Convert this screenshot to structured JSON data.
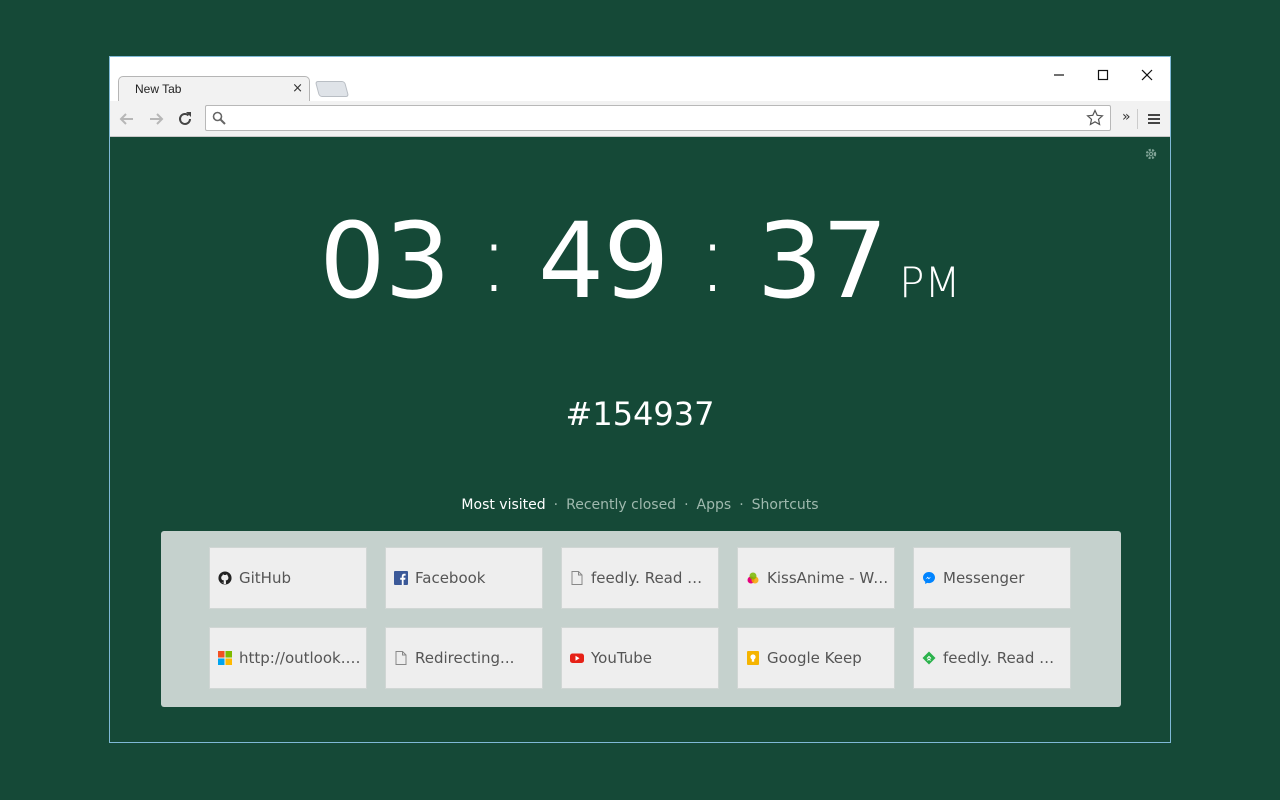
{
  "browser": {
    "tab": {
      "title": "New Tab",
      "close_glyph": "×"
    },
    "window_controls": {
      "minimize": "—",
      "maximize": "☐",
      "close": "✕"
    },
    "omnibox": {
      "value": "",
      "placeholder": ""
    },
    "extensions_overflow": "»"
  },
  "clock": {
    "hours": "03",
    "minutes": "49",
    "seconds": "37",
    "separator": ":",
    "ampm": "PM"
  },
  "color": {
    "hex": "#154937"
  },
  "nav": {
    "items": [
      {
        "label": "Most visited",
        "active": true
      },
      {
        "label": "Recently closed",
        "active": false
      },
      {
        "label": "Apps",
        "active": false
      },
      {
        "label": "Shortcuts",
        "active": false
      }
    ],
    "separator": "·"
  },
  "tiles": [
    {
      "label": "GitHub",
      "icon": "github-icon"
    },
    {
      "label": "Facebook",
      "icon": "facebook-icon"
    },
    {
      "label": "feedly. Read more, know more.",
      "icon": "page-icon"
    },
    {
      "label": "KissAnime - Watch anime online",
      "icon": "kissanime-icon"
    },
    {
      "label": "Messenger",
      "icon": "messenger-icon"
    },
    {
      "label": "http://outlook.com",
      "icon": "microsoft-icon"
    },
    {
      "label": "Redirecting...",
      "icon": "page-icon"
    },
    {
      "label": "YouTube",
      "icon": "youtube-icon"
    },
    {
      "label": "Google Keep",
      "icon": "keep-icon"
    },
    {
      "label": "feedly. Read more, know more.",
      "icon": "feedly-icon"
    }
  ],
  "colors": {
    "background": "#154937",
    "panel": "#c5d1cd",
    "tile": "#eeeeee",
    "facebook": "#3b5998",
    "youtube": "#e62117",
    "keep": "#f5b400",
    "feedly": "#2bb24c",
    "messenger": "#0084ff"
  }
}
